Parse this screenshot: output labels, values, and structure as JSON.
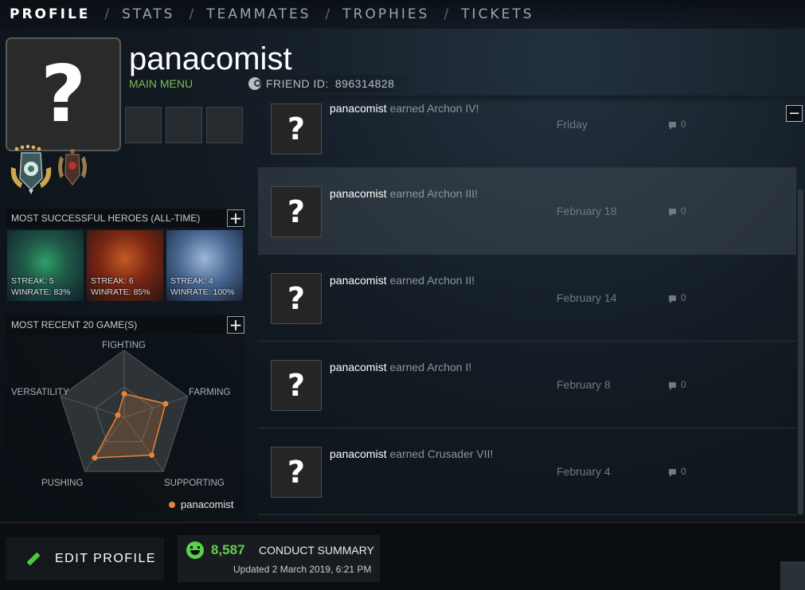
{
  "nav": {
    "tabs": [
      "PROFILE",
      "STATS",
      "TEAMMATES",
      "TROPHIES",
      "TICKETS"
    ],
    "separator": "/",
    "active": "PROFILE"
  },
  "profile": {
    "avatar_glyph": "?",
    "username": "panacomist",
    "main_menu": "MAIN MENU",
    "friend_id_label": "FRIEND ID:",
    "friend_id": "896314828"
  },
  "heroes_panel": {
    "title": "MOST SUCCESSFUL HEROES (ALL-TIME)",
    "plus": "+",
    "heroes": [
      {
        "streak": "STREAK: 5",
        "winrate": "WINRATE: 83%"
      },
      {
        "streak": "STREAK: 6",
        "winrate": "WINRATE: 85%"
      },
      {
        "streak": "STREAK: 4",
        "winrate": "WINRATE: 100%"
      }
    ]
  },
  "recent_panel": {
    "title": "MOST RECENT 20 GAME(S)",
    "plus": "+",
    "axes": [
      "FIGHTING",
      "FARMING",
      "SUPPORTING",
      "PUSHING",
      "VERSATILITY"
    ],
    "values": [
      0.35,
      0.65,
      0.7,
      0.75,
      0.1
    ],
    "legend": "panacomist",
    "series_color": "#e8833a"
  },
  "feed": {
    "collapse": "−",
    "items": [
      {
        "user": "panacomist",
        "text": " earned Archon IV!",
        "date": "Friday",
        "comments": "0"
      },
      {
        "user": "panacomist",
        "text": " earned Archon III!",
        "date": "February 18",
        "comments": "0"
      },
      {
        "user": "panacomist",
        "text": " earned Archon II!",
        "date": "February 14",
        "comments": "0"
      },
      {
        "user": "panacomist",
        "text": " earned Archon I!",
        "date": "February 8",
        "comments": "0"
      },
      {
        "user": "panacomist",
        "text": " earned Crusader VII!",
        "date": "February 4",
        "comments": "0"
      }
    ]
  },
  "bottom": {
    "edit_profile": "EDIT PROFILE",
    "conduct_score": "8,587",
    "conduct_title": "CONDUCT SUMMARY",
    "conduct_updated": "Updated 2 March 2019, 6:21 PM"
  },
  "colors": {
    "accent_green": "#62cf4d",
    "radar_orange": "#e8833a"
  }
}
